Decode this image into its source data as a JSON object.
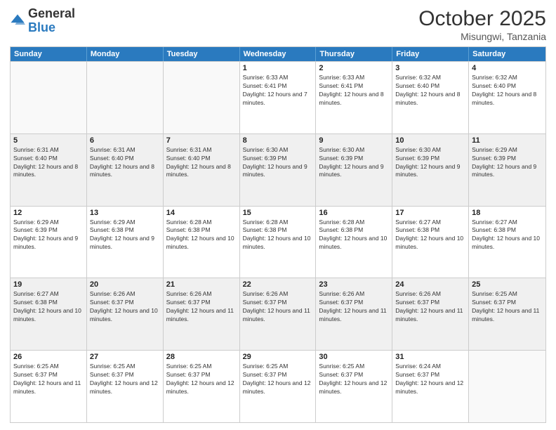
{
  "logo": {
    "general": "General",
    "blue": "Blue"
  },
  "title": "October 2025",
  "location": "Misungwi, Tanzania",
  "days": [
    "Sunday",
    "Monday",
    "Tuesday",
    "Wednesday",
    "Thursday",
    "Friday",
    "Saturday"
  ],
  "weeks": [
    [
      {
        "day": "",
        "info": ""
      },
      {
        "day": "",
        "info": ""
      },
      {
        "day": "",
        "info": ""
      },
      {
        "day": "1",
        "info": "Sunrise: 6:33 AM\nSunset: 6:41 PM\nDaylight: 12 hours and 7 minutes."
      },
      {
        "day": "2",
        "info": "Sunrise: 6:33 AM\nSunset: 6:41 PM\nDaylight: 12 hours and 8 minutes."
      },
      {
        "day": "3",
        "info": "Sunrise: 6:32 AM\nSunset: 6:40 PM\nDaylight: 12 hours and 8 minutes."
      },
      {
        "day": "4",
        "info": "Sunrise: 6:32 AM\nSunset: 6:40 PM\nDaylight: 12 hours and 8 minutes."
      }
    ],
    [
      {
        "day": "5",
        "info": "Sunrise: 6:31 AM\nSunset: 6:40 PM\nDaylight: 12 hours and 8 minutes."
      },
      {
        "day": "6",
        "info": "Sunrise: 6:31 AM\nSunset: 6:40 PM\nDaylight: 12 hours and 8 minutes."
      },
      {
        "day": "7",
        "info": "Sunrise: 6:31 AM\nSunset: 6:40 PM\nDaylight: 12 hours and 8 minutes."
      },
      {
        "day": "8",
        "info": "Sunrise: 6:30 AM\nSunset: 6:39 PM\nDaylight: 12 hours and 9 minutes."
      },
      {
        "day": "9",
        "info": "Sunrise: 6:30 AM\nSunset: 6:39 PM\nDaylight: 12 hours and 9 minutes."
      },
      {
        "day": "10",
        "info": "Sunrise: 6:30 AM\nSunset: 6:39 PM\nDaylight: 12 hours and 9 minutes."
      },
      {
        "day": "11",
        "info": "Sunrise: 6:29 AM\nSunset: 6:39 PM\nDaylight: 12 hours and 9 minutes."
      }
    ],
    [
      {
        "day": "12",
        "info": "Sunrise: 6:29 AM\nSunset: 6:39 PM\nDaylight: 12 hours and 9 minutes."
      },
      {
        "day": "13",
        "info": "Sunrise: 6:29 AM\nSunset: 6:38 PM\nDaylight: 12 hours and 9 minutes."
      },
      {
        "day": "14",
        "info": "Sunrise: 6:28 AM\nSunset: 6:38 PM\nDaylight: 12 hours and 10 minutes."
      },
      {
        "day": "15",
        "info": "Sunrise: 6:28 AM\nSunset: 6:38 PM\nDaylight: 12 hours and 10 minutes."
      },
      {
        "day": "16",
        "info": "Sunrise: 6:28 AM\nSunset: 6:38 PM\nDaylight: 12 hours and 10 minutes."
      },
      {
        "day": "17",
        "info": "Sunrise: 6:27 AM\nSunset: 6:38 PM\nDaylight: 12 hours and 10 minutes."
      },
      {
        "day": "18",
        "info": "Sunrise: 6:27 AM\nSunset: 6:38 PM\nDaylight: 12 hours and 10 minutes."
      }
    ],
    [
      {
        "day": "19",
        "info": "Sunrise: 6:27 AM\nSunset: 6:38 PM\nDaylight: 12 hours and 10 minutes."
      },
      {
        "day": "20",
        "info": "Sunrise: 6:26 AM\nSunset: 6:37 PM\nDaylight: 12 hours and 10 minutes."
      },
      {
        "day": "21",
        "info": "Sunrise: 6:26 AM\nSunset: 6:37 PM\nDaylight: 12 hours and 11 minutes."
      },
      {
        "day": "22",
        "info": "Sunrise: 6:26 AM\nSunset: 6:37 PM\nDaylight: 12 hours and 11 minutes."
      },
      {
        "day": "23",
        "info": "Sunrise: 6:26 AM\nSunset: 6:37 PM\nDaylight: 12 hours and 11 minutes."
      },
      {
        "day": "24",
        "info": "Sunrise: 6:26 AM\nSunset: 6:37 PM\nDaylight: 12 hours and 11 minutes."
      },
      {
        "day": "25",
        "info": "Sunrise: 6:25 AM\nSunset: 6:37 PM\nDaylight: 12 hours and 11 minutes."
      }
    ],
    [
      {
        "day": "26",
        "info": "Sunrise: 6:25 AM\nSunset: 6:37 PM\nDaylight: 12 hours and 11 minutes."
      },
      {
        "day": "27",
        "info": "Sunrise: 6:25 AM\nSunset: 6:37 PM\nDaylight: 12 hours and 12 minutes."
      },
      {
        "day": "28",
        "info": "Sunrise: 6:25 AM\nSunset: 6:37 PM\nDaylight: 12 hours and 12 minutes."
      },
      {
        "day": "29",
        "info": "Sunrise: 6:25 AM\nSunset: 6:37 PM\nDaylight: 12 hours and 12 minutes."
      },
      {
        "day": "30",
        "info": "Sunrise: 6:25 AM\nSunset: 6:37 PM\nDaylight: 12 hours and 12 minutes."
      },
      {
        "day": "31",
        "info": "Sunrise: 6:24 AM\nSunset: 6:37 PM\nDaylight: 12 hours and 12 minutes."
      },
      {
        "day": "",
        "info": ""
      }
    ]
  ]
}
